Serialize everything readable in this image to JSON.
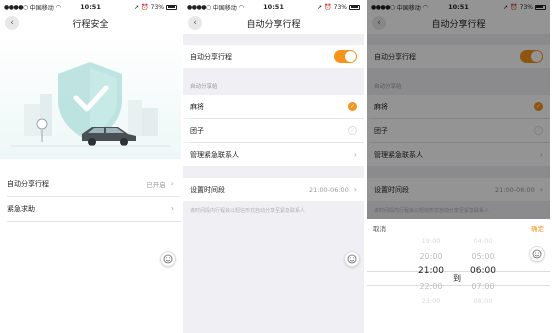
{
  "status": {
    "carrier": "中国移动",
    "time": "10:51",
    "battery": "73%"
  },
  "screen1": {
    "title": "行程安全",
    "rows": [
      {
        "label": "自动分享行程",
        "value": "已开启"
      },
      {
        "label": "紧急求助",
        "value": ""
      }
    ]
  },
  "screen2": {
    "title": "自动分享行程",
    "toggle_label": "自动分享行程",
    "section_title": "自动分享给",
    "contacts": [
      {
        "name": "麻将",
        "checked": true
      },
      {
        "name": "团子",
        "checked": false
      }
    ],
    "manage_label": "管理紧急联系人",
    "time_label": "设置时间段",
    "time_value": "21:00-06:00",
    "note": "该时间段内行程会以短信形式自动分享至紧急联系人"
  },
  "screen3": {
    "title": "自动分享行程",
    "toggle_label": "自动分享行程",
    "section_title": "自动分享给",
    "contacts": [
      {
        "name": "麻将",
        "checked": true
      },
      {
        "name": "团子",
        "checked": false
      }
    ],
    "manage_label": "管理紧急联系人",
    "time_label": "设置时间段",
    "time_value": "21:00-06:00",
    "note": "该时间段内行程会以短信形式自动分享至紧急联系人",
    "picker": {
      "cancel": "取消",
      "confirm": "确定",
      "to": "到",
      "start_hours": [
        "19:00",
        "20:00",
        "21:00",
        "22:00",
        "23:00"
      ],
      "end_hours": [
        "04:00",
        "05:00",
        "06:00",
        "07:00",
        "08:00"
      ]
    }
  },
  "colors": {
    "accent": "#f5931b",
    "shield": "#b7e0de",
    "bg": "#efeff4"
  }
}
